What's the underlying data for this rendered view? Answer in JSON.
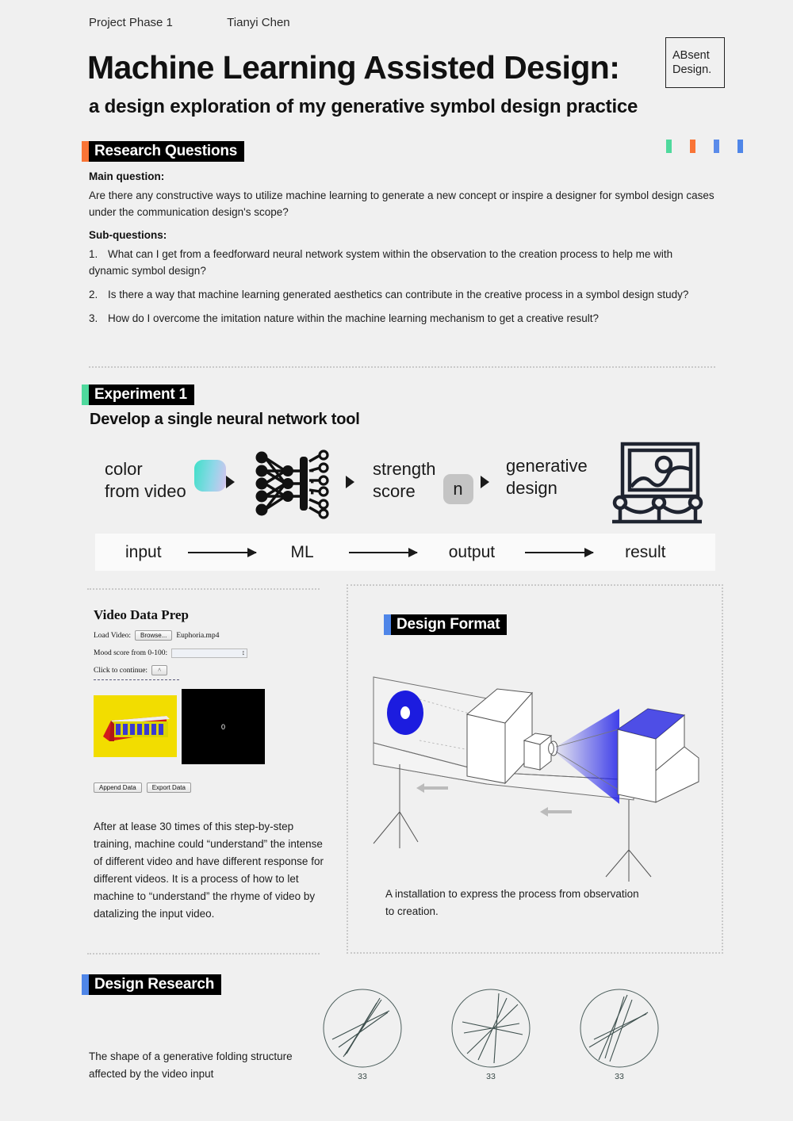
{
  "header": {
    "phase": "Project Phase 1",
    "author": "Tianyi Chen",
    "title": "Machine Learning Assisted Design:",
    "subtitle": "a design exploration of my generative symbol design practice",
    "logo_line1": "ABsent",
    "logo_line2": "Design."
  },
  "accents": {
    "green": "#4fd99d",
    "orange": "#f97436",
    "blue": "#5a8bea",
    "blue2": "#4f86e8",
    "black": "#000000"
  },
  "dots": [
    "#4fd99d",
    "#f97436",
    "#5a8bea",
    "#4f86e8"
  ],
  "research": {
    "heading": "Research Questions",
    "main_label": "Main question:",
    "main_text": "Are there any constructive ways to utilize machine learning to generate a new concept or inspire a designer for symbol design cases under the communication design's scope?",
    "sub_label": "Sub-questions:",
    "sub_questions": [
      {
        "n": "1.",
        "text": "What can I get from a feedforward neural network system within the observation to the creation process to help me with dynamic symbol design?"
      },
      {
        "n": "2.",
        "text": "Is there a way that machine learning generated aesthetics can contribute in the creative process in a symbol design study?"
      },
      {
        "n": "3.",
        "text": "How do I overcome the imitation nature within the machine learning mechanism to get a creative result?"
      }
    ]
  },
  "experiment": {
    "heading": "Experiment 1",
    "subheading": "Develop a single neural network tool",
    "pipeline": {
      "step1_line1": "color",
      "step1_line2": "from video",
      "step3_line1": "strength",
      "step3_line2": "score",
      "score_badge": "n",
      "step4_line1": "generative",
      "step4_line2": "design"
    },
    "flow": [
      "input",
      "ML",
      "output",
      "result"
    ]
  },
  "video_prep": {
    "title": "Video Data Prep",
    "load_label": "Load Video:",
    "browse_button": "Browse...",
    "filename": "Euphoria.mp4",
    "mood_label": "Mood score from 0-100:",
    "mood_value": "",
    "continue_label": "Click to continue:",
    "continue_button": "^",
    "black_panel_value": "0",
    "append_button": "Append Data",
    "export_button": "Export Data",
    "body": "After at lease 30 times of this step-by-step training, machine could “understand” the intense of different video and have different response for different videos. It is a process of how to let machine to “understand” the rhyme of video by datalizing the input video."
  },
  "design_format": {
    "heading": "Design Format",
    "caption": "A installation to express the process from observation to creation."
  },
  "design_research": {
    "heading": "Design Research",
    "caption": "The shape of a generative folding structure affected by the video input",
    "circles": [
      {
        "label": "33"
      },
      {
        "label": "33"
      },
      {
        "label": "33"
      }
    ]
  }
}
